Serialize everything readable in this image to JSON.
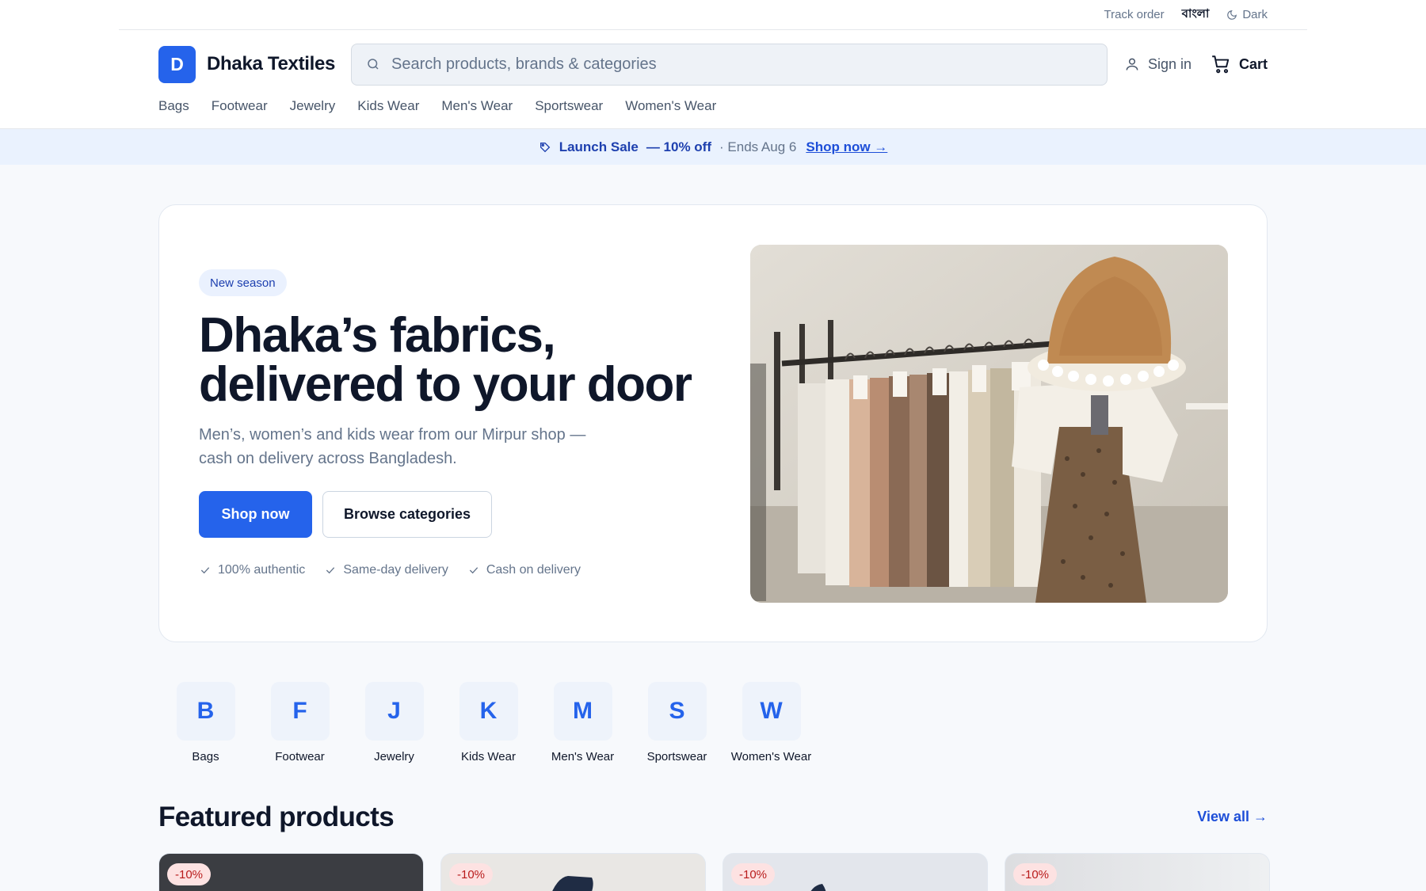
{
  "utility": {
    "track_order": "Track order",
    "language": "বাংলা",
    "theme_toggle": "Dark"
  },
  "brand": {
    "initial": "D",
    "name": "Dhaka Textiles",
    "accent": "#2563eb"
  },
  "search": {
    "placeholder": "Search products, brands & categories",
    "value": ""
  },
  "account": {
    "sign_in": "Sign in",
    "cart": "Cart"
  },
  "nav": {
    "categories": [
      "Bags",
      "Footwear",
      "Jewelry",
      "Kids Wear",
      "Men's Wear",
      "Sportswear",
      "Women's Wear"
    ]
  },
  "promo": {
    "title": "Launch Sale",
    "discount": "— 10% off",
    "ends": "· Ends Aug 6",
    "cta": "Shop now →"
  },
  "hero": {
    "badge": "New season",
    "headline": "Dhaka’s fabrics, delivered to your door",
    "subhead": "Men’s, women’s and kids wear from our Mirpur shop — cash on delivery across Bangladesh.",
    "primary_cta": "Shop now",
    "secondary_cta": "Browse categories",
    "features": [
      "100% authentic",
      "Same-day delivery",
      "Cash on delivery"
    ],
    "image": "clothing-rack-with-straw-hat"
  },
  "category_tiles": [
    {
      "letter": "B",
      "label": "Bags"
    },
    {
      "letter": "F",
      "label": "Footwear"
    },
    {
      "letter": "J",
      "label": "Jewelry"
    },
    {
      "letter": "K",
      "label": "Kids Wear"
    },
    {
      "letter": "M",
      "label": "Men's Wear"
    },
    {
      "letter": "S",
      "label": "Sportswear"
    },
    {
      "letter": "W",
      "label": "Women's Wear"
    }
  ],
  "featured": {
    "title": "Featured products",
    "view_all": "View all →",
    "products": [
      {
        "discount": "-10%"
      },
      {
        "discount": "-10%"
      },
      {
        "discount": "-10%"
      },
      {
        "discount": "-10%"
      }
    ]
  },
  "colors": {
    "primary": "#2563eb",
    "promo_bg": "#eaf2fe",
    "sale_tag_bg": "#fde2e2",
    "sale_tag_text": "#b91c1c"
  }
}
